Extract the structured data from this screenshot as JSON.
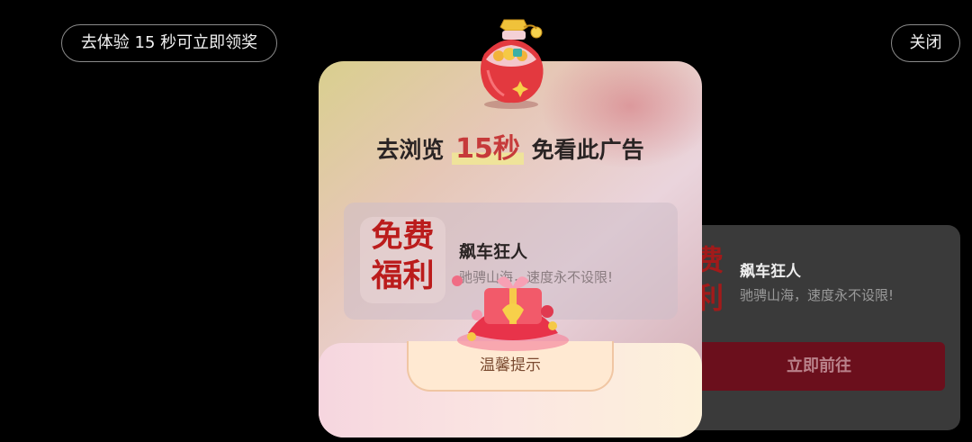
{
  "top_bar": {
    "skip_label": "去体验 15 秒可立即领奖",
    "close_label": "关闭"
  },
  "background_ad": {
    "badge_line1": "费",
    "badge_line2": "利",
    "title": "飙车狂人",
    "description": "驰骋山海，速度永不设限!",
    "cta_label": "立即前往"
  },
  "popup": {
    "title_prefix": "去浏览",
    "title_highlight": "15秒",
    "title_suffix": "免看此广告",
    "card": {
      "badge_line1": "免费",
      "badge_line2": "福利",
      "title": "飙车狂人",
      "description": "驰骋山海，速度永不设限!"
    },
    "tip_label": "温馨提示"
  },
  "icons": {
    "jar": "treasure-jar-icon",
    "gift": "gift-box-icon"
  },
  "colors": {
    "accent_red": "#c63a3a",
    "cta_dark_red": "#6b0f1c",
    "badge_red": "#bb1c1c"
  }
}
